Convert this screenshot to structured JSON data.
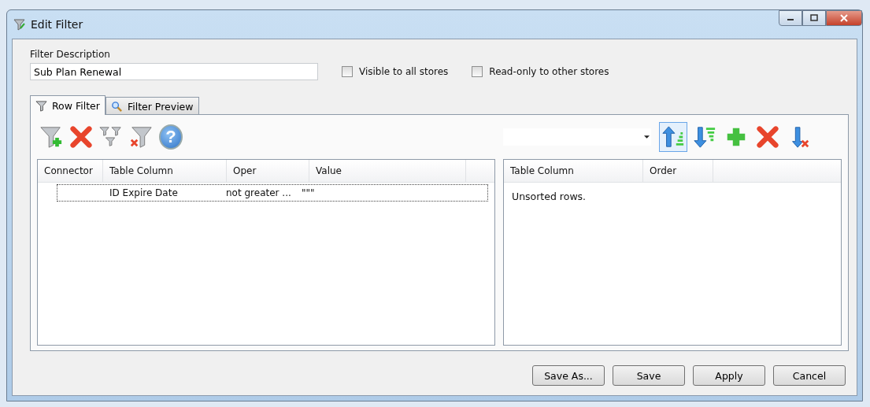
{
  "window": {
    "title": "Edit Filter"
  },
  "filter_description": {
    "label": "Filter Description",
    "value": "Sub Plan Renewal"
  },
  "options": [
    {
      "label": "Visible to all stores",
      "checked": false
    },
    {
      "label": "Read-only to other stores",
      "checked": false
    }
  ],
  "tabs": [
    {
      "label": "Row Filter",
      "kind": "funnel",
      "selected": true
    },
    {
      "label": "Filter Preview",
      "kind": "search",
      "selected": false
    }
  ],
  "row_filter": {
    "toolbar": [
      {
        "kind": "add-funnel"
      },
      {
        "kind": "delete"
      },
      {
        "kind": "funnel-group"
      },
      {
        "kind": "remove-funnel"
      },
      {
        "kind": "help",
        "glyph": "?"
      }
    ],
    "columns": [
      "Connector",
      "Table Column",
      "Oper",
      "Value"
    ],
    "rows": [
      {
        "table_column": "ID Expire Date",
        "oper": "not greater ...",
        "value": "\"\"\"",
        "focused": true
      }
    ]
  },
  "sort": {
    "toolbar": [
      {
        "kind": "sort-ascending",
        "pressed": true
      },
      {
        "kind": "sort-descending",
        "pressed": false
      },
      {
        "kind": "add",
        "pressed": false
      },
      {
        "kind": "delete",
        "pressed": false
      },
      {
        "kind": "clear-sort",
        "pressed": false
      }
    ],
    "columns": [
      "Table Column",
      "Order"
    ],
    "empty_message": "Unsorted rows."
  },
  "buttons": [
    "Save As...",
    "Save",
    "Apply",
    "Cancel"
  ]
}
